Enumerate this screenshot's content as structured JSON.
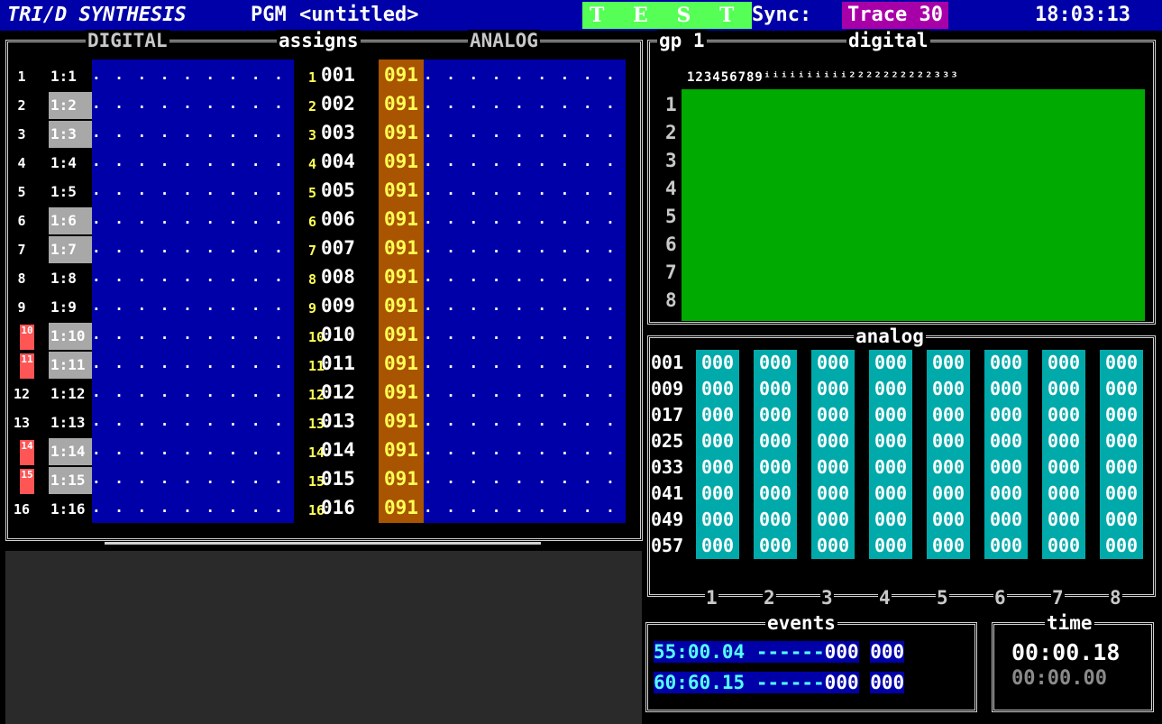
{
  "title_bar": {
    "logo": "TRI/D SYNTHESIS",
    "pgm_label": "PGM",
    "program_name": "<untitled>",
    "mode_badge": "T E S T",
    "sync_label": "Sync:",
    "sync_value": "Trace 30",
    "clock": "18:03:13"
  },
  "left_panel": {
    "digital_header": "DIGITAL",
    "assigns_header": "assigns",
    "analog_header": "ANALOG",
    "rows": [
      {
        "num": "1",
        "ch": "1:1",
        "sub": "1",
        "assign": "001",
        "value": "091"
      },
      {
        "num": "2",
        "ch": "1:2",
        "sub": "2",
        "assign": "002",
        "value": "091"
      },
      {
        "num": "3",
        "ch": "1:3",
        "sub": "3",
        "assign": "003",
        "value": "091"
      },
      {
        "num": "4",
        "ch": "1:4",
        "sub": "4",
        "assign": "004",
        "value": "091"
      },
      {
        "num": "5",
        "ch": "1:5",
        "sub": "5",
        "assign": "005",
        "value": "091"
      },
      {
        "num": "6",
        "ch": "1:6",
        "sub": "6",
        "assign": "006",
        "value": "091"
      },
      {
        "num": "7",
        "ch": "1:7",
        "sub": "7",
        "assign": "007",
        "value": "091"
      },
      {
        "num": "8",
        "ch": "1:8",
        "sub": "8",
        "assign": "008",
        "value": "091"
      },
      {
        "num": "9",
        "ch": "1:9",
        "sub": "9",
        "assign": "009",
        "value": "091"
      },
      {
        "num": "10",
        "ch": "1:10",
        "sub": "10",
        "assign": "010",
        "value": "091"
      },
      {
        "num": "11",
        "ch": "1:11",
        "sub": "11",
        "assign": "011",
        "value": "091"
      },
      {
        "num": "12",
        "ch": "1:12",
        "sub": "12",
        "assign": "012",
        "value": "091"
      },
      {
        "num": "13",
        "ch": "1:13",
        "sub": "13",
        "assign": "013",
        "value": "091"
      },
      {
        "num": "14",
        "ch": "1:14",
        "sub": "14",
        "assign": "014",
        "value": "091"
      },
      {
        "num": "15",
        "ch": "1:15",
        "sub": "15",
        "assign": "015",
        "value": "091"
      },
      {
        "num": "16",
        "ch": "1:16",
        "sub": "16",
        "assign": "016",
        "value": "091"
      }
    ],
    "dots": ". . . . . . . . . . . . . . ."
  },
  "digital_panel": {
    "group_label": "gp 1",
    "title": "digital",
    "column_header": "123456789ⁱⁱⁱⁱⁱⁱⁱⁱⁱⁱ²²²²²²²²²²³³³",
    "row_labels": [
      "1",
      "2",
      "3",
      "4",
      "5",
      "6",
      "7",
      "8"
    ]
  },
  "analog_panel": {
    "title": "analog",
    "row_labels": [
      "001",
      "009",
      "017",
      "025",
      "033",
      "041",
      "049",
      "057"
    ],
    "cell_value": "000",
    "column_labels": [
      "1",
      "2",
      "3",
      "4",
      "5",
      "6",
      "7",
      "8"
    ]
  },
  "events_panel": {
    "title": "events",
    "rows": [
      {
        "time": "55:00.04",
        "dashes": "------",
        "a": "000",
        "b": "000"
      },
      {
        "time": "60:60.15",
        "dashes": "------",
        "a": "000",
        "b": "000"
      }
    ]
  },
  "time_panel": {
    "title": "time",
    "current": "00:00.18",
    "secondary": "00:00.00"
  },
  "colors": {
    "blue": "#0000a8",
    "green": "#00aa00",
    "cyan": "#00aaaa",
    "brown": "#a85400",
    "highlight_red": "#ff5555",
    "grey": "#a8a8a8"
  }
}
